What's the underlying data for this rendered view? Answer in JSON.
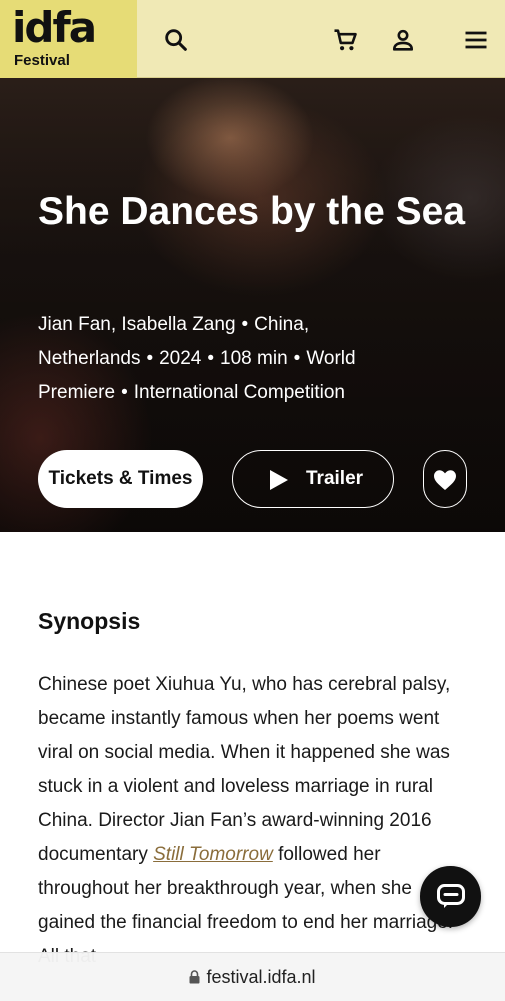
{
  "header": {
    "logo_word": "idfa",
    "logo_sub": "Festival",
    "icons": [
      "search-icon",
      "cart-icon",
      "account-icon",
      "menu-icon"
    ],
    "background": "#f0e9b5",
    "logo_background": "#e6dc76"
  },
  "film": {
    "title": "She Dances by the Sea",
    "directors": "Jian Fan, Isabella Zang",
    "country1": "China,",
    "country2": "Netherlands",
    "year": "2024",
    "duration": "108 min",
    "premiere1": "World",
    "premiere2": "Premiere",
    "section": "International Competition",
    "separator": "•"
  },
  "actions": {
    "tickets_label": "Tickets & Times",
    "trailer_label": "Trailer",
    "favorite_icon": "heart-icon"
  },
  "synopsis": {
    "heading": "Synopsis",
    "text_before_link": "Chinese poet Xiuhua Yu, who has cerebral palsy, became instantly famous when her poems went viral on social media. When it happened she was stuck in a violent and loveless marriage in rural China. Director Jian Fan’s award-winning 2016 documentary ",
    "link_text": "Still Tomorrow",
    "text_after_link": " followed her throughout her breakthrough year, when she gained the financial freedom to end her marriage. All that"
  },
  "chat": {
    "icon": "chat-icon"
  },
  "browser": {
    "url": "festival.idfa.nl",
    "lock_icon": "lock-icon"
  }
}
